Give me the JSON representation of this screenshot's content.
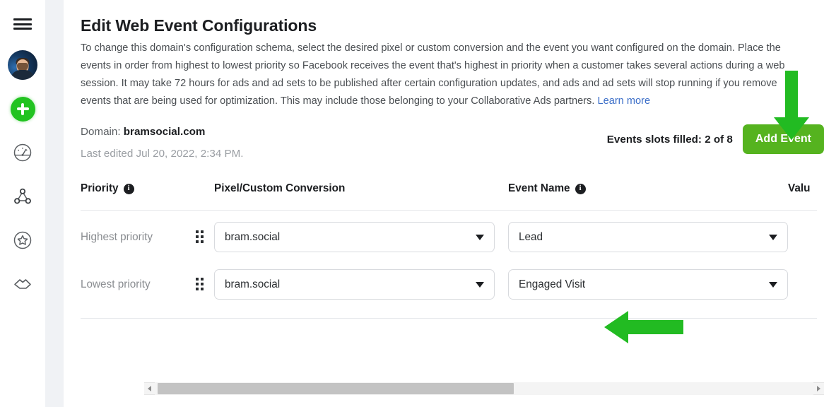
{
  "sidebar": {
    "items": [
      {
        "name": "menu-icon",
        "label": "Menu"
      },
      {
        "name": "avatar",
        "label": "Profile"
      },
      {
        "name": "create-icon",
        "label": "Create"
      },
      {
        "name": "gauge-icon",
        "label": "Ads Manager"
      },
      {
        "name": "network-icon",
        "label": "Events Manager"
      },
      {
        "name": "star-icon",
        "label": "Brand Safety"
      },
      {
        "name": "handshake-icon",
        "label": "Partners"
      }
    ]
  },
  "page": {
    "title": "Edit Web Event Configurations",
    "description": "To change this domain's configuration schema, select the desired pixel or custom conversion and the event you want configured on the domain. Place the events in order from highest to lowest priority so Facebook receives the event that's highest in priority when a customer takes several actions during a web session. It may take 72 hours for ads and ad sets to be published after certain configuration updates, and ads and ad sets will stop running if you remove events that are being used for optimization. This may include those belonging to your Collaborative Ads partners. ",
    "learn_more": "Learn more",
    "domain_label": "Domain: ",
    "domain_value": "bramsocial.com",
    "last_edited": "Last edited Jul 20, 2022, 2:34 PM.",
    "slots_filled": "Events slots filled: 2 of 8",
    "add_event_label": "Add Event"
  },
  "table": {
    "headers": {
      "priority": "Priority",
      "pixel": "Pixel/Custom Conversion",
      "event_name": "Event Name",
      "value": "Valu"
    },
    "info_glyph": "i",
    "rows": [
      {
        "priority_label": "Highest priority",
        "pixel": "bram.social",
        "event": "Lead"
      },
      {
        "priority_label": "Lowest priority",
        "pixel": "bram.social",
        "event": "Engaged Visit"
      }
    ]
  },
  "colors": {
    "add_event_green": "#55b31f",
    "annotation_green": "#22bb22",
    "create_green": "#22c321",
    "link_blue": "#3b6ec8",
    "gutter_gray": "#f0f2f5"
  }
}
